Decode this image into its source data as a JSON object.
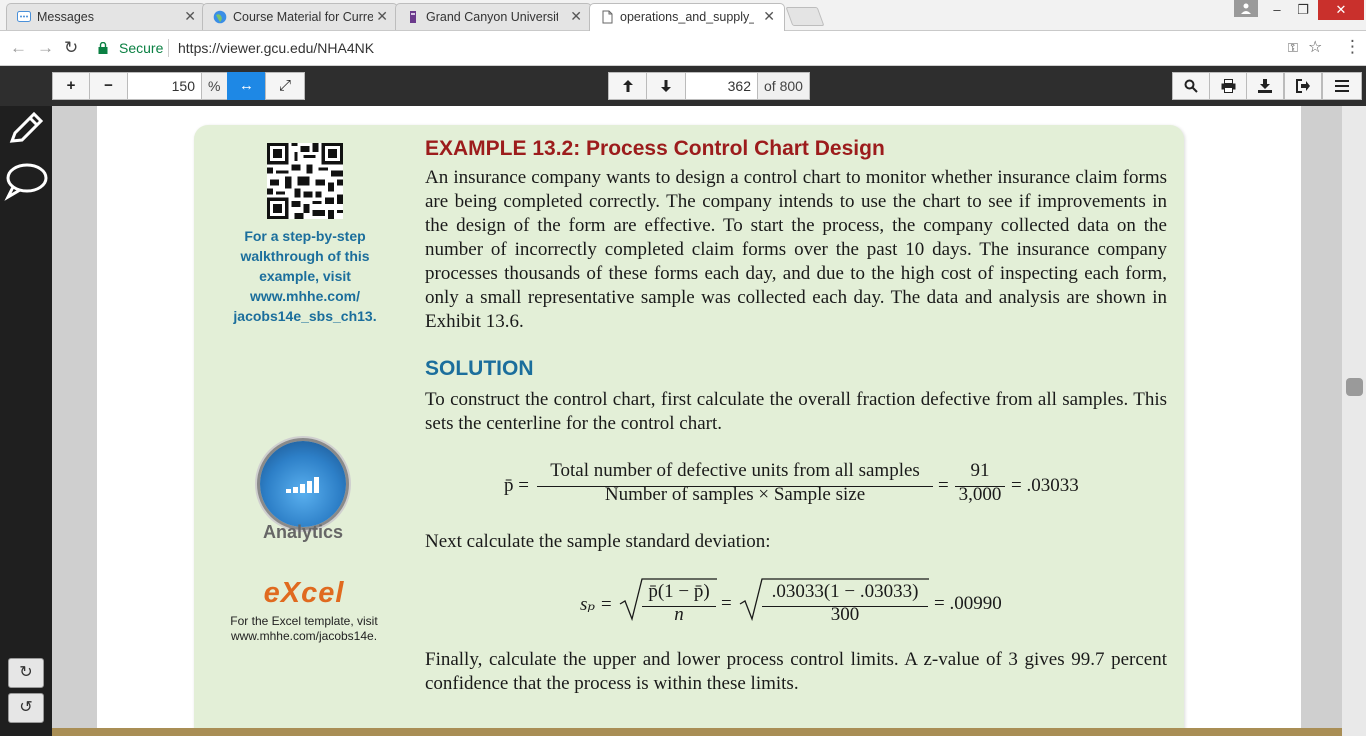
{
  "browser": {
    "tabs": [
      {
        "label": "Messages",
        "icon": "messages-icon"
      },
      {
        "label": "Course Material for Curre",
        "icon": "globe-icon"
      },
      {
        "label": "Grand Canyon University",
        "icon": "gcu-icon"
      },
      {
        "label": "operations_and_supply_c",
        "icon": "document-icon",
        "active": true
      }
    ],
    "close_glyph": "✕",
    "window_controls": {
      "minimize": "–",
      "restore": "❐",
      "close": "✕"
    },
    "address": {
      "secure_label": "Secure",
      "url": "https://viewer.gcu.edu/NHA4NK"
    }
  },
  "viewer_toolbar": {
    "zoom_in": "+",
    "zoom_out": "−",
    "zoom_value": "150",
    "zoom_unit": "%",
    "fit_width": "↔",
    "fullscreen": "⤢",
    "prev_page": "🡑",
    "next_page": "🡓",
    "page_number": "362",
    "page_total": "of 800"
  },
  "side_rail": {
    "rotate_cw": "↻",
    "rotate_ccw": "↺"
  },
  "content": {
    "example_title": "EXAMPLE 13.2: Process Control Chart Design",
    "walkthrough": "For a step-by-step walkthrough of this example, visit www.mhhe.com/ jacobs14e_sbs_ch13.",
    "intro_paragraph": "An insurance company wants to design a control chart to monitor whether insurance claim forms are being completed correctly. The company intends to use the chart to see if improve­ments in the design of the form are effective. To start the process, the company collected data on the number of incorrectly completed claim forms over the past 10 days. The insurance company processes thousands of these forms each day, and due to the high cost of inspecting each form, only a small representative sample was collected each day. The data and analysis are shown in Exhibit 13.6.",
    "solution_heading": "SOLUTION",
    "solution_paragraph": "To construct the control chart, first calculate the overall fraction defective from all samples. This sets the centerline for the control chart.",
    "eq1": {
      "lhs": "p̄ =",
      "numerator": "Total number of defective units from all samples",
      "denominator": "Number of samples × Sample size",
      "eq_sign": "=",
      "num2": "91",
      "den2": "3,000",
      "result": "= .03033"
    },
    "next_sentence": "Next calculate the sample standard deviation:",
    "eq2": {
      "lhs": "sₚ =",
      "num": "p̄(1 − p̄)",
      "den": "n",
      "eq_sign": "=",
      "num2": ".03033(1 − .03033)",
      "den2": "300",
      "result": "= .00990"
    },
    "final_paragraph": "Finally, calculate the upper and lower process control limits. A z-value of 3 gives 99.7 percent confidence that the process is within these limits.",
    "analytics_label": "Analytics",
    "excel_logo": "eXcel",
    "excel_note": "For the Excel template, visit www.mhhe.com/jacobs14e."
  }
}
